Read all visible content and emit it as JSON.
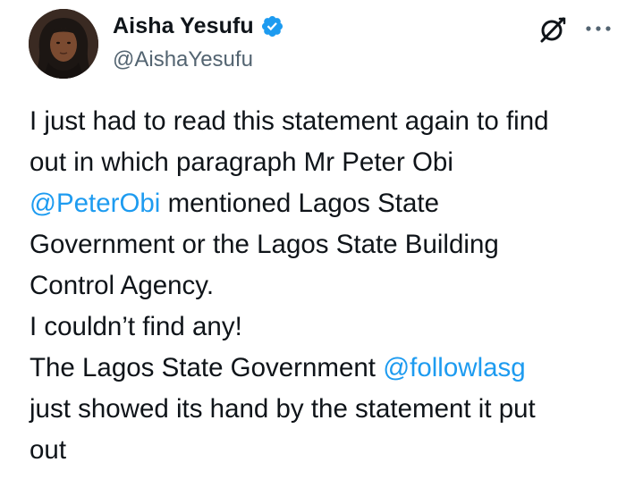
{
  "author": {
    "display_name": "Aisha Yesufu",
    "handle": "@AishaYesufu",
    "verified": true
  },
  "actions": {
    "grok_icon": "grok-icon",
    "more_icon": "more-icon"
  },
  "colors": {
    "text": "#0f1419",
    "secondary": "#536471",
    "accent": "#1d9bf0"
  },
  "tweet": {
    "line1": "I just had to read this statement again to find",
    "line2": "out in which paragraph Mr Peter Obi",
    "line3_mention": "@PeterObi",
    "line3_rest": " mentioned Lagos State",
    "line4": "Government or the Lagos State Building",
    "line5": "Control Agency.",
    "line6": "I couldn’t find any!",
    "line7_text": "The Lagos State Government ",
    "line7_mention": "@followlasg",
    "line8": "just showed its hand by the statement it put",
    "line9": "out"
  }
}
